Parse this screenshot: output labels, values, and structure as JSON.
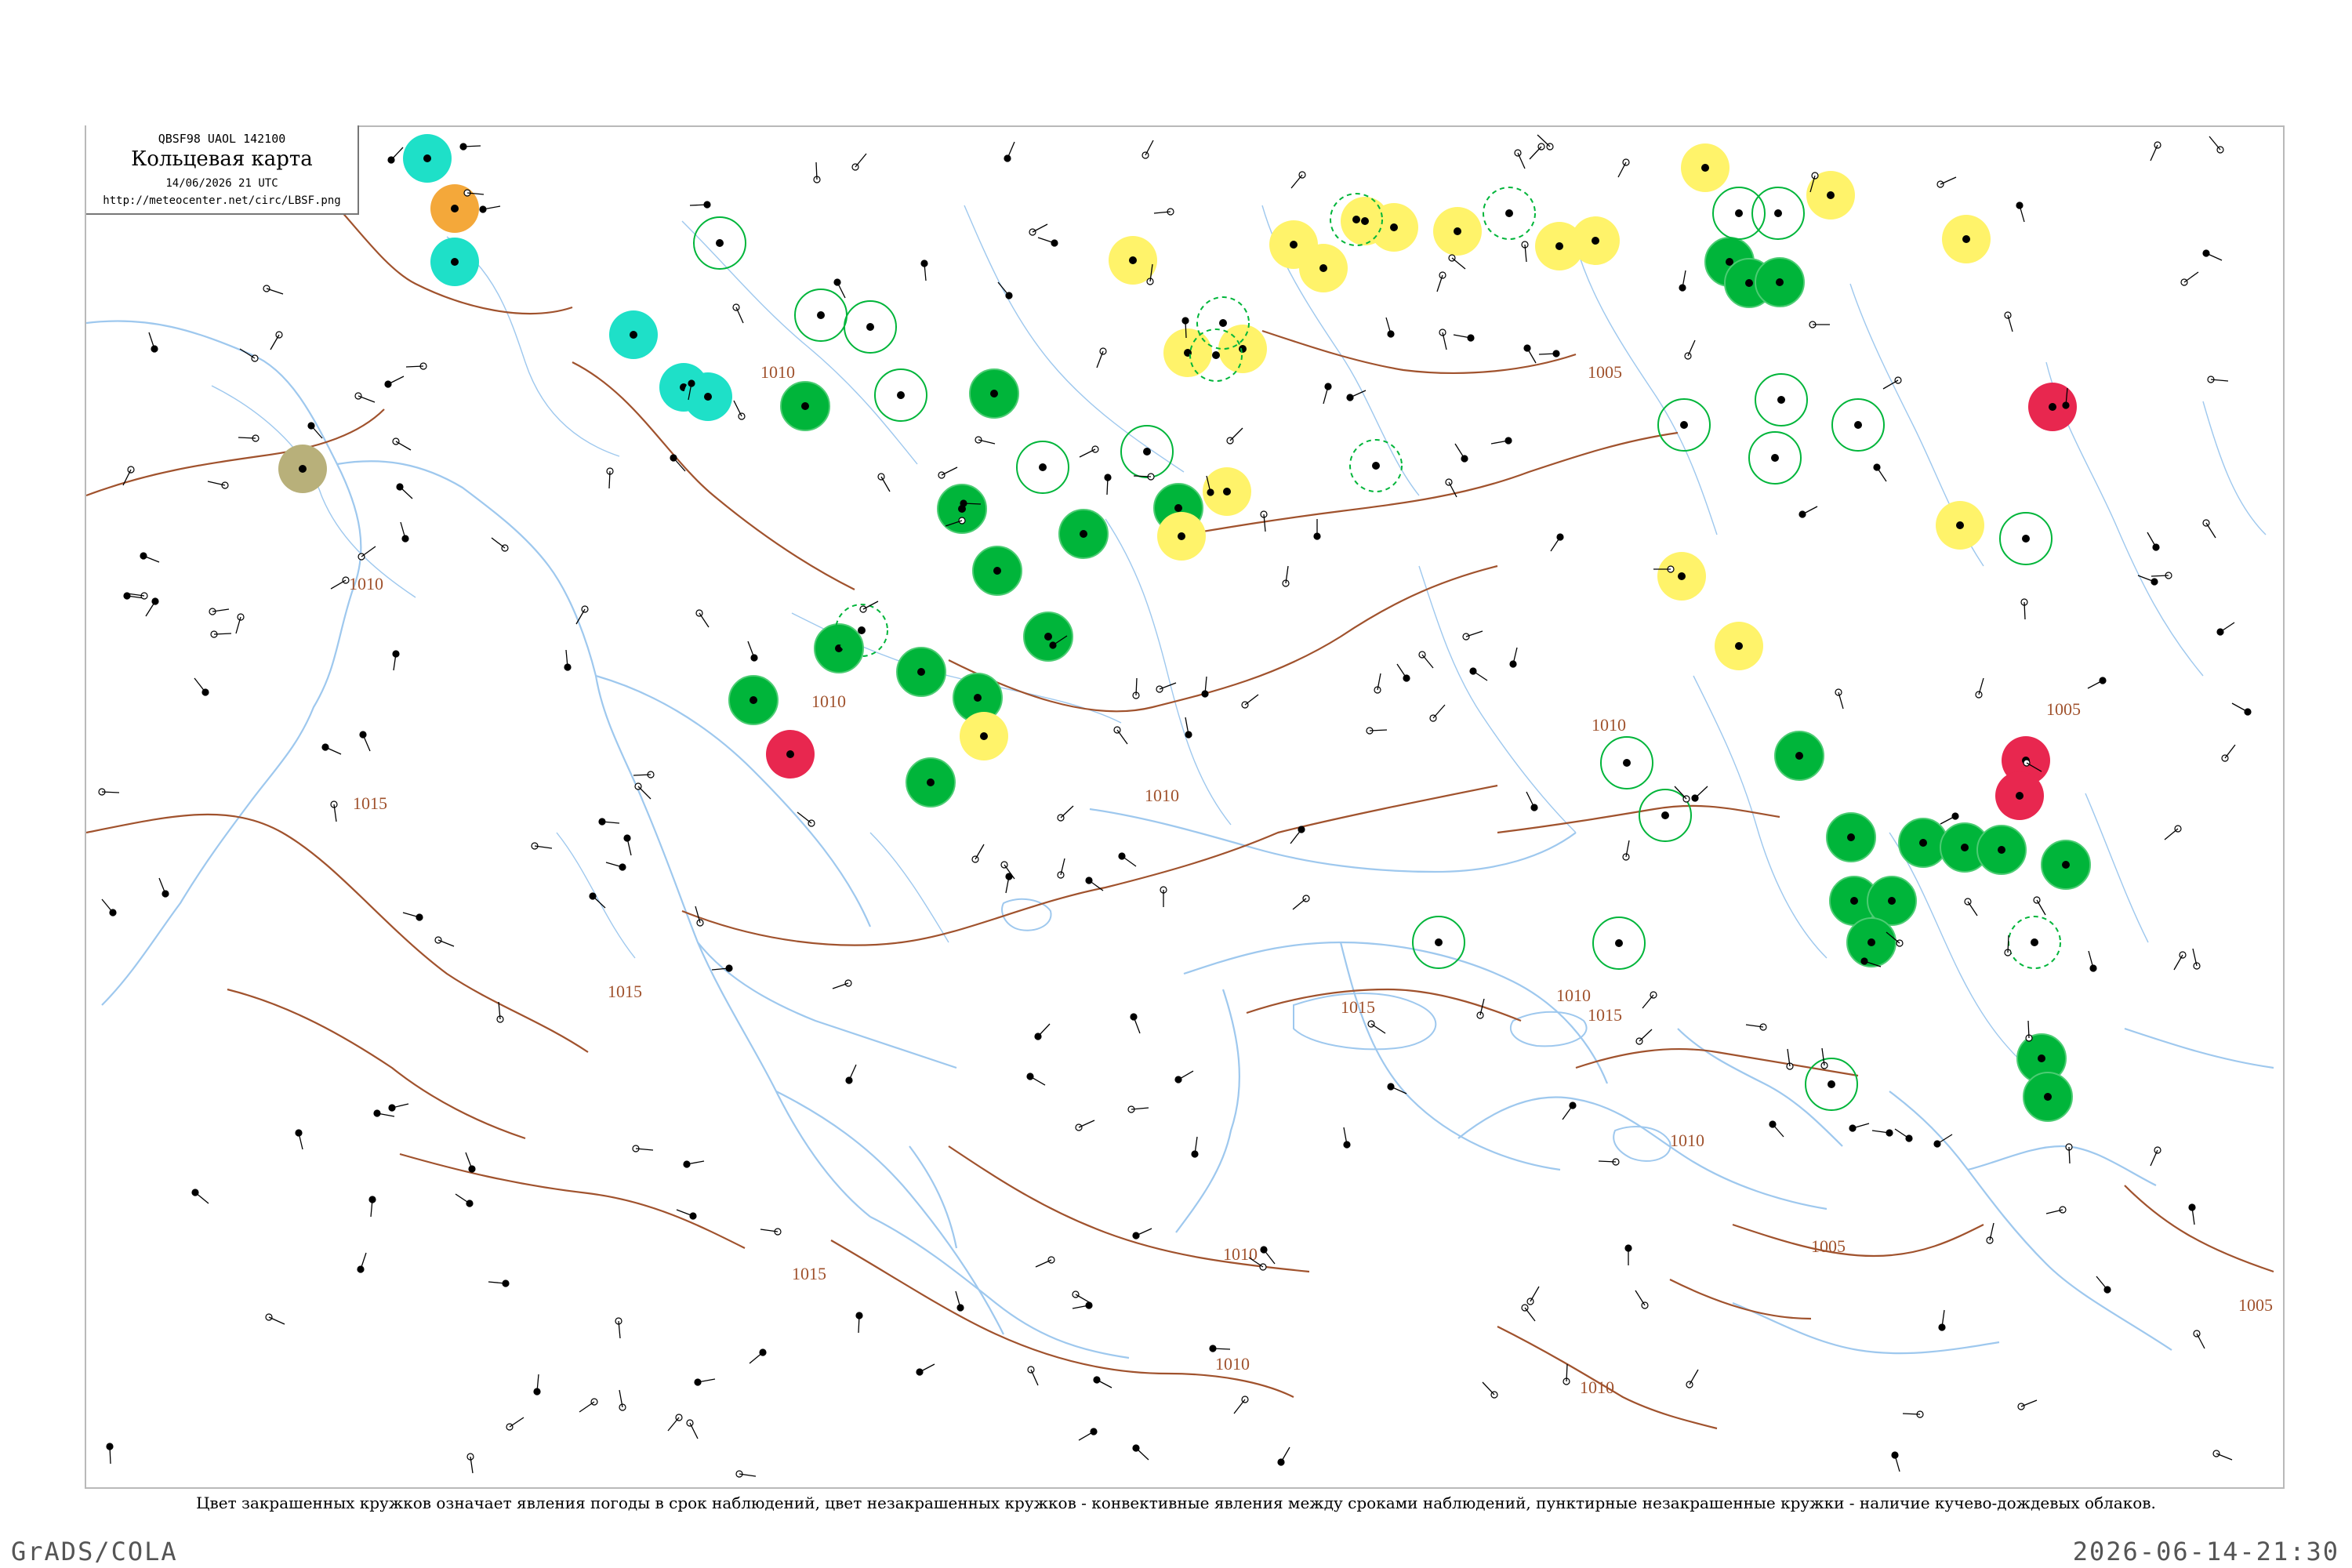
{
  "header": {
    "code": "QBSF98  UAOL  142100",
    "title": "Кольцевая карта",
    "time": "14/06/2026 21 UTC",
    "url": "http://meteocenter.net/circ/LBSF.png"
  },
  "caption": "Цвет закрашенных кружков означает явления погоды в срок наблюдений, цвет незакрашенных кружков - конвективные явления между сроками наблюдений, пунктирные незакрашенные кружки - наличие кучево-дождевых облаков.",
  "footer": {
    "left": "GrADS/COLA",
    "right": "2026-06-14-21:30"
  },
  "colors": {
    "isobar": "#a0522d",
    "coast": "#9ec8ee",
    "green": "#00b53a",
    "cyan": "#1ee0c8",
    "orange": "#f4a83a",
    "yellow": "#fff36a",
    "red": "#e8274f",
    "olive": "#b8b07a"
  },
  "isobar_labels": [
    "1005",
    "1010",
    "1015"
  ],
  "station_types": [
    "filled-green",
    "filled-yellow",
    "filled-red",
    "filled-cyan",
    "filled-orange",
    "filled-olive",
    "open-green",
    "dashed-green"
  ]
}
